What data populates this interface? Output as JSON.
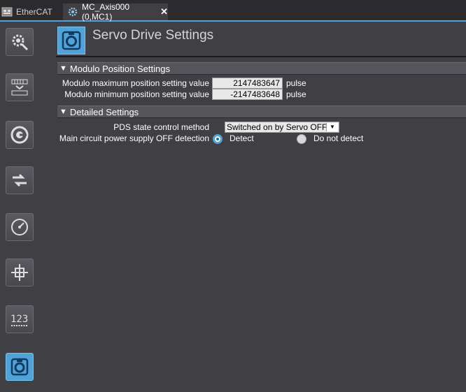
{
  "tabs": [
    {
      "label": "EtherCAT",
      "icon": "ethercat-icon"
    },
    {
      "label": "MC_Axis000 (0,MC1)",
      "icon": "axis-gear-icon",
      "close": "✕"
    }
  ],
  "sidebar": [
    {
      "name": "unit-conversion-settings-icon"
    },
    {
      "name": "operation-settings-icon"
    },
    {
      "name": "other-operation-settings-icon"
    },
    {
      "name": "limit-settings-icon"
    },
    {
      "name": "position-count-settings-icon"
    },
    {
      "name": "servo-drive-settings-icon"
    },
    {
      "name": "numeric-settings-icon"
    },
    {
      "name": "servo-drive-active-icon",
      "active": true
    }
  ],
  "page": {
    "title": "Servo Drive Settings"
  },
  "modulo": {
    "header": "Modulo Position Settings",
    "max_label": "Modulo maximum position setting value",
    "max_value": "2147483647",
    "min_label": "Modulo minimum position setting value",
    "min_value": "-2147483648",
    "unit": "pulse"
  },
  "detailed": {
    "header": "Detailed Settings",
    "pds_label": "PDS state control method",
    "pds_value": "Switched on by Servo OFF",
    "main_circuit_label": "Main circuit power supply OFF detection",
    "option_detect": "Detect",
    "option_no_detect": "Do not detect",
    "selected": "Detect"
  },
  "colors": {
    "accent": "#4fa3d9",
    "background": "#3f3f44"
  }
}
